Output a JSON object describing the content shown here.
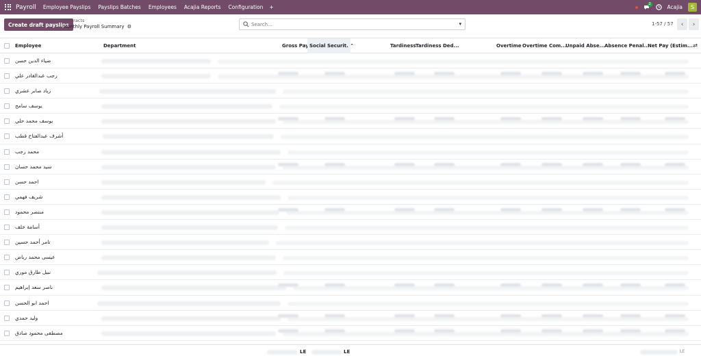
{
  "navbar": {
    "brand": "Payroll",
    "menu": [
      "Employee Payslips",
      "Payslips Batches",
      "Employees",
      "Acajia Reports",
      "Configuration"
    ],
    "plus": "+",
    "chat_count": "2",
    "company": "Acajia",
    "avatar_letter": "S"
  },
  "controls": {
    "create_button": "Create draft payslips",
    "breadcrumb_parent": "Contracts",
    "breadcrumb_current": "Monthly Payroll Summary",
    "search_placeholder": "Search...",
    "pager": "1-57 / 57"
  },
  "table": {
    "columns": [
      "Employee",
      "Department",
      "Gross Pay",
      "Social Securit.",
      "Tardiness",
      "Tardiness Ded...",
      "Overtime",
      "Overtime Com...",
      "Unpaid Abse...",
      "Absence Penal...",
      "Net Pay (Estim..."
    ],
    "sorted_column": "Social Securit.",
    "rows": [
      "ضياء الدين حسن",
      "رجب عبدالقادر علي",
      "زياد صابر عشري",
      "يوسف سامح",
      "يوسف محمد حلي",
      "أشرف عبدالفتاح قطب",
      "محمد رجب",
      "سيد محمد حسان",
      "احمد حسن",
      "شريف فهمي",
      "منتصر محمود",
      "أسامة خلف",
      "تامر أحمد حسين",
      "عيسى محمد رياض",
      "نبيل طارق موري",
      "ناصر سعد إبراهيم",
      "احمد ابو الحسن",
      "وليد حمدي",
      "مصطفى محمود صادق"
    ],
    "footer_currency": "LE"
  },
  "colors": {
    "brand": "#714B67",
    "accent_green": "#28a745",
    "avatar": "#a3b836"
  }
}
